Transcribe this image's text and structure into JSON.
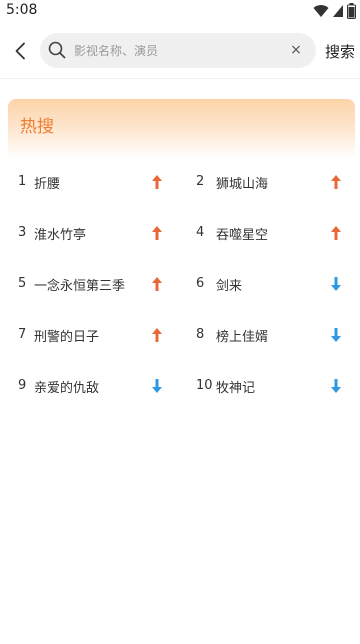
{
  "status_bar": {
    "time": "5:08",
    "icons": [
      "wifi-icon",
      "signal-icon",
      "battery-icon"
    ]
  },
  "search": {
    "placeholder": "影视名称、演员",
    "value": "",
    "submit_label": "搜索",
    "clear_glyph": "×"
  },
  "hot": {
    "title": "热搜",
    "items": [
      {
        "rank": "1",
        "name": "折腰",
        "trend": "up"
      },
      {
        "rank": "2",
        "name": "狮城山海",
        "trend": "up"
      },
      {
        "rank": "3",
        "name": "淮水竹亭",
        "trend": "up"
      },
      {
        "rank": "4",
        "name": "吞噬星空",
        "trend": "up"
      },
      {
        "rank": "5",
        "name": "一念永恒第三季",
        "trend": "up"
      },
      {
        "rank": "6",
        "name": "剑来",
        "trend": "down"
      },
      {
        "rank": "7",
        "name": "刑警的日子",
        "trend": "up"
      },
      {
        "rank": "8",
        "name": "榜上佳婿",
        "trend": "down"
      },
      {
        "rank": "9",
        "name": "亲爱的仇敌",
        "trend": "down"
      },
      {
        "rank": "10",
        "name": "牧神记",
        "trend": "down"
      }
    ]
  },
  "colors": {
    "accent": "#ee7d33",
    "trend_up": "#e8683a",
    "trend_down": "#2f98e2"
  }
}
